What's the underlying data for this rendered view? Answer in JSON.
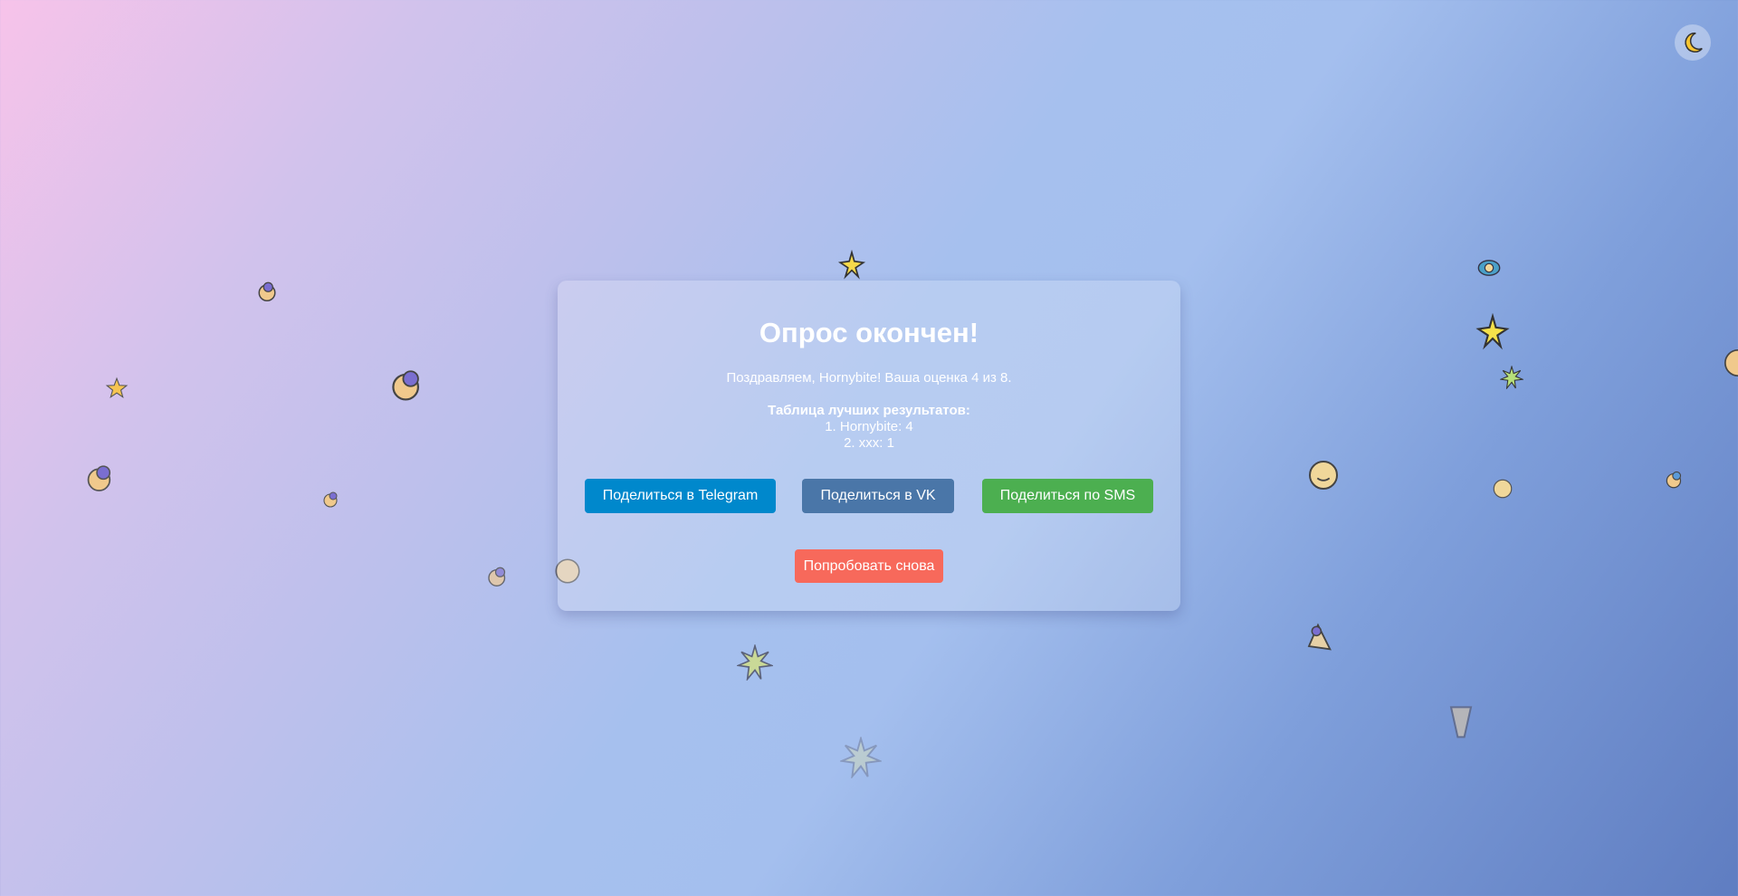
{
  "theme_toggle": {
    "icon": "moon-icon"
  },
  "quiz": {
    "title": "Опрос окончен!",
    "result": "Поздравляем, Hornybite! Ваша оценка 4 из 8.",
    "leaderboard": {
      "title": "Таблица лучших результатов:",
      "entries": [
        "1. Hornybite: 4",
        "2. xxx: 1"
      ]
    },
    "buttons": {
      "telegram": "Поделиться в Telegram",
      "vk": "Поделиться в VK",
      "sms": "Поделиться по SMS",
      "retry": "Попробовать снова"
    }
  },
  "colors": {
    "telegram": "#0088cc",
    "vk": "#4a76a8",
    "sms": "#4caf50",
    "retry": "#f7695b"
  },
  "decorations": [
    "star-icon",
    "sparkle-icon",
    "bouquet-icon",
    "face-icon"
  ]
}
